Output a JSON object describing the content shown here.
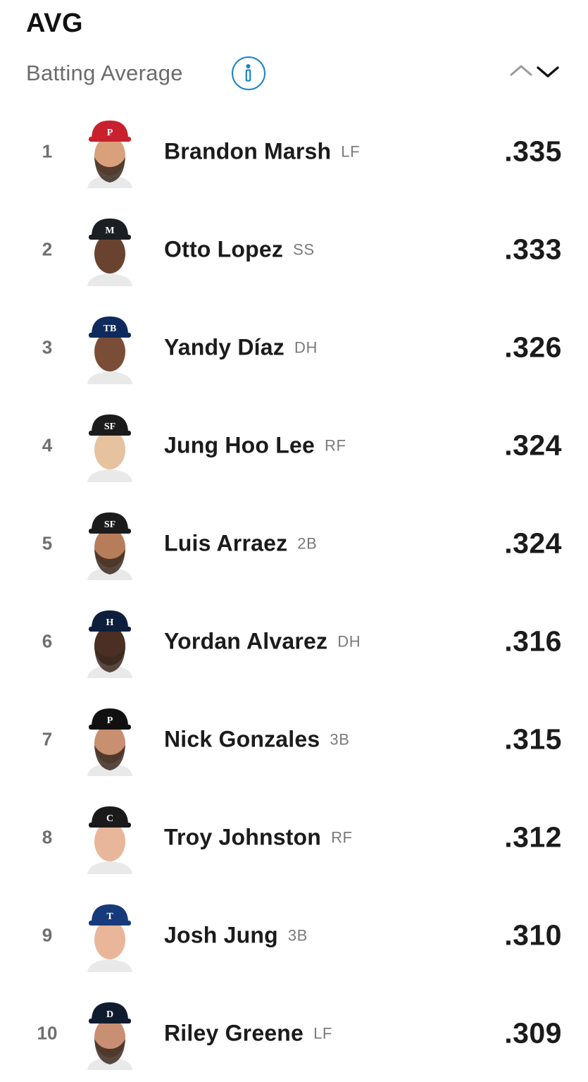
{
  "header": {
    "title": "AVG",
    "subtitle": "Batting Average",
    "info_icon": "info-circle-icon",
    "sort_icons": [
      "chevron-up-icon",
      "chevron-down-icon"
    ],
    "accent_color": "#1a83c6"
  },
  "leaders": [
    {
      "rank": "1",
      "name": "Brandon Marsh",
      "position": "LF",
      "value": ".335",
      "cap_color": "#c8202d",
      "cap_letter": "P",
      "skin": "#d9a07c",
      "beard": true
    },
    {
      "rank": "2",
      "name": "Otto Lopez",
      "position": "SS",
      "value": ".333",
      "cap_color": "#1b1f24",
      "cap_letter": "M",
      "skin": "#6a4330",
      "beard": false
    },
    {
      "rank": "3",
      "name": "Yandy Díaz",
      "position": "DH",
      "value": ".326",
      "cap_color": "#0f2a5c",
      "cap_letter": "TB",
      "skin": "#7a4e36",
      "beard": false
    },
    {
      "rank": "4",
      "name": "Jung Hoo Lee",
      "position": "RF",
      "value": ".324",
      "cap_color": "#1b1b1b",
      "cap_letter": "SF",
      "skin": "#e7c29f",
      "beard": false
    },
    {
      "rank": "5",
      "name": "Luis Arraez",
      "position": "2B",
      "value": ".324",
      "cap_color": "#1b1b1b",
      "cap_letter": "SF",
      "skin": "#b77d5a",
      "beard": true
    },
    {
      "rank": "6",
      "name": "Yordan Alvarez",
      "position": "DH",
      "value": ".316",
      "cap_color": "#0d1f3c",
      "cap_letter": "H",
      "skin": "#4a2f22",
      "beard": true
    },
    {
      "rank": "7",
      "name": "Nick Gonzales",
      "position": "3B",
      "value": ".315",
      "cap_color": "#111111",
      "cap_letter": "P",
      "skin": "#c89070",
      "beard": true
    },
    {
      "rank": "8",
      "name": "Troy Johnston",
      "position": "RF",
      "value": ".312",
      "cap_color": "#1a1a1a",
      "cap_letter": "C",
      "skin": "#e8b79b",
      "beard": false
    },
    {
      "rank": "9",
      "name": "Josh Jung",
      "position": "3B",
      "value": ".310",
      "cap_color": "#173a7a",
      "cap_letter": "T",
      "skin": "#eab69a",
      "beard": false
    },
    {
      "rank": "10",
      "name": "Riley Greene",
      "position": "LF",
      "value": ".309",
      "cap_color": "#0f1b2e",
      "cap_letter": "D",
      "skin": "#c98f72",
      "beard": true
    }
  ]
}
